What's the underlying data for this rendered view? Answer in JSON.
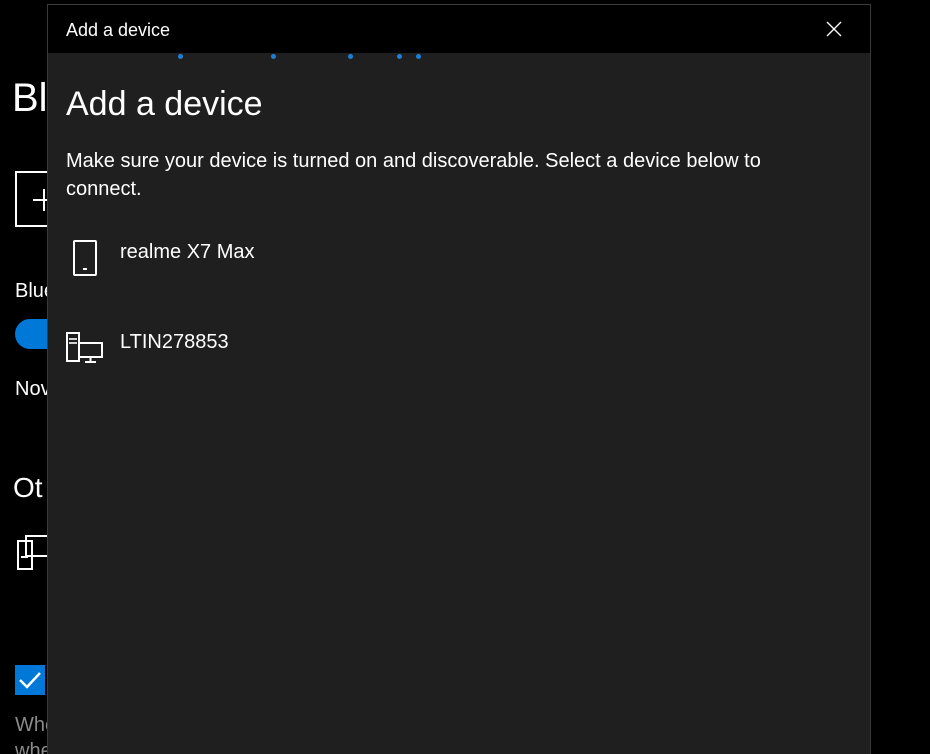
{
  "background": {
    "title_fragment": "Blu",
    "bluetooth_label_fragment": "Blue",
    "now_text_fragment": "Nov",
    "other_heading_fragment": "Ot",
    "small_text_line1": "Whe",
    "small_text_line2": "whe",
    "toggle_state": "on",
    "checkbox_state": "checked",
    "accent_color": "#0078d7"
  },
  "dialog": {
    "titlebar_title": "Add a device",
    "heading": "Add a device",
    "instructions": "Make sure your device is turned on and discoverable. Select a device below to connect.",
    "close_icon": "close-icon",
    "progress_state": "searching",
    "devices": [
      {
        "name": "realme X7 Max",
        "icon": "phone-icon"
      },
      {
        "name": "LTIN278853",
        "icon": "computer-icon"
      }
    ]
  }
}
